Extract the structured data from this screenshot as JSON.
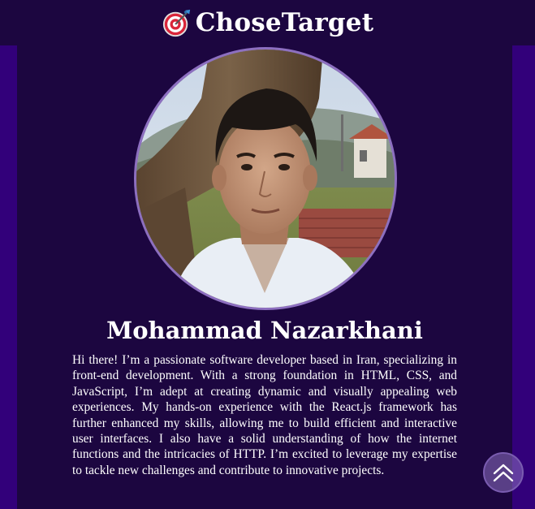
{
  "header": {
    "brand_name": "ChoseTarget",
    "brand_icon": "dart-target-icon"
  },
  "profile": {
    "photo": "profile-photo",
    "name": "Mohammad Nazarkhani",
    "bio": "Hi there! I’m a passionate software developer based in Iran, specializing in front-end development. With a strong foundation in HTML, CSS, and JavaScript, I’m adept at creating dynamic and visually appealing web experiences. My hands-on experience with the React.js framework has further enhanced my skills, allowing me to build efficient and interactive user interfaces. I also have a solid understanding of how the internet functions and the intricacies of HTTP. I’m excited to leverage my expertise to tackle new challenges and contribute to innovative projects."
  },
  "scroll_top": {
    "icon": "double-chevron-up-icon"
  },
  "colors": {
    "page_background": "#32007a",
    "panel_background": "#1c0640",
    "photo_border": "#8d6fc0",
    "text": "#ffffff"
  }
}
